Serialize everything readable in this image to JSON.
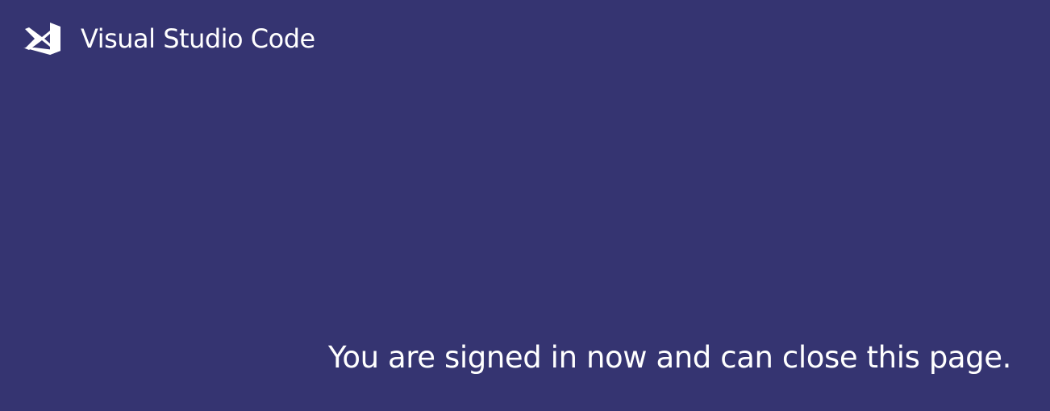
{
  "header": {
    "logo_icon": "vscode-logo-icon",
    "title": "Visual Studio Code"
  },
  "main": {
    "message": "You are signed in now and can close this page."
  },
  "colors": {
    "background": "#353471",
    "text": "#ffffff"
  }
}
